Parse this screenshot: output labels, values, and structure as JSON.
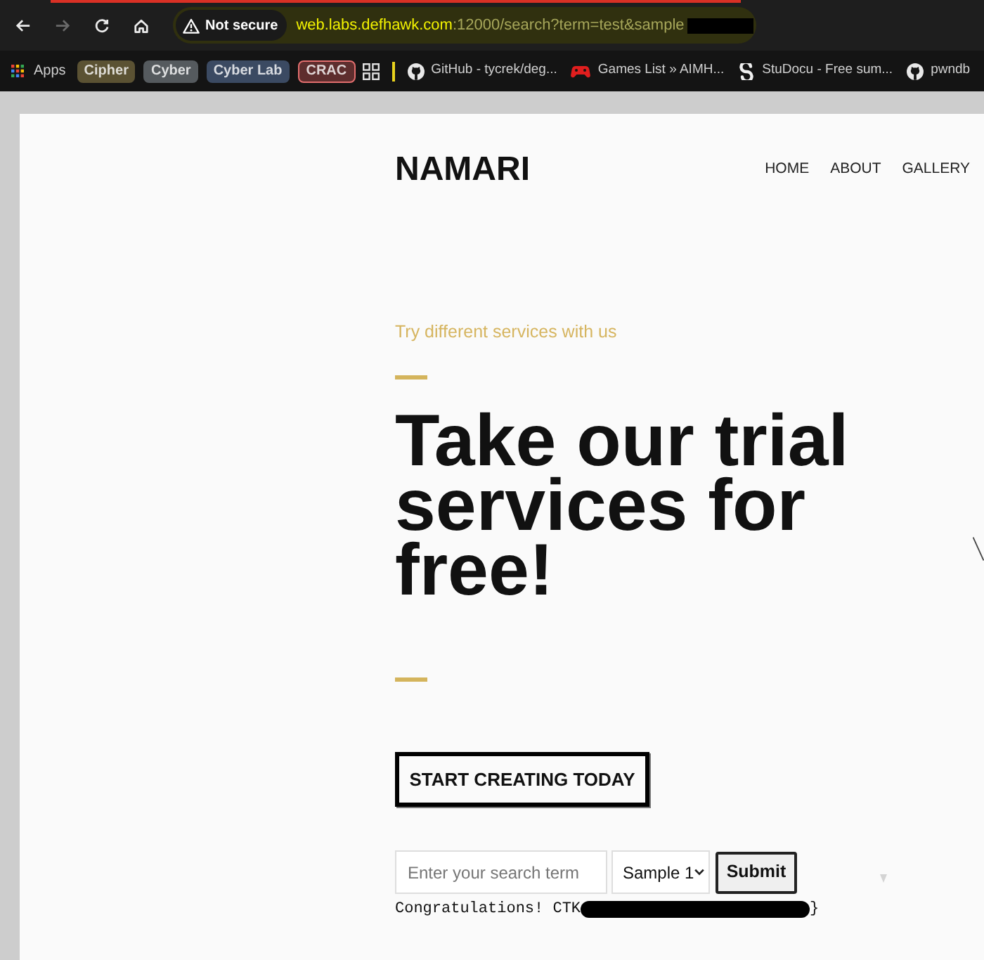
{
  "browser": {
    "nav_buttons": [
      {
        "kind": "back",
        "disabled": false
      },
      {
        "kind": "forward",
        "disabled": true
      },
      {
        "kind": "reload",
        "disabled": false
      },
      {
        "kind": "home",
        "disabled": false
      }
    ],
    "address_bar": {
      "security_label": "Not secure",
      "url_host": "web.labs.defhawk.com",
      "url_rest": ":12000/search?term=test&sample",
      "redacted": true
    }
  },
  "bookmarks_bar": {
    "apps_label": "Apps",
    "folders": [
      {
        "label": "Cipher",
        "color": "#5b5233",
        "outlined": false
      },
      {
        "label": "Cyber",
        "color": "#555a5e",
        "outlined": false
      },
      {
        "label": "Cyber Lab",
        "color": "#3b4a62",
        "outlined": false
      },
      {
        "label": "CRAC",
        "color": "#5e2e2e",
        "outlined": true
      }
    ],
    "links": [
      {
        "kind": "github",
        "label": "GitHub - tycrek/deg..."
      },
      {
        "kind": "gamepad",
        "label": "Games List » AIMH..."
      },
      {
        "kind": "studocu",
        "label": "StuDocu - Free sum..."
      },
      {
        "kind": "github",
        "label": "pwndb"
      }
    ]
  },
  "page": {
    "logo": "NAMARI",
    "nav": [
      "HOME",
      "ABOUT",
      "GALLERY"
    ],
    "tagline": "Try different services with us",
    "heading": "Take our trial services for free!",
    "cta": "START CREATING TODAY",
    "search_form": {
      "placeholder": "Enter your search term",
      "select_value": "Sample 1",
      "submit": "Submit"
    },
    "result": {
      "text": "Congratulations! CTK",
      "redacted": true,
      "suffix": "}"
    }
  }
}
